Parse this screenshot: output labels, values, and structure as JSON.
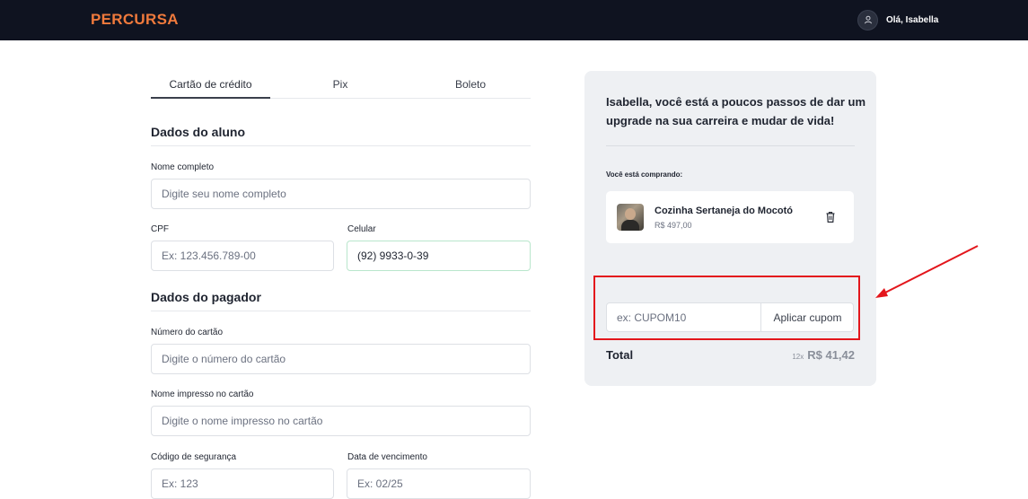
{
  "header": {
    "logo": "PERCURSA",
    "greeting": "Olá, Isabella",
    "user_icon": "user-icon"
  },
  "tabs": [
    {
      "label": "Cartão de crédito",
      "active": true
    },
    {
      "label": "Pix",
      "active": false
    },
    {
      "label": "Boleto",
      "active": false
    }
  ],
  "student": {
    "title": "Dados do aluno",
    "full_name": {
      "label": "Nome completo",
      "placeholder": "Digite seu nome completo"
    },
    "cpf": {
      "label": "CPF",
      "placeholder": "Ex: 123.456.789-00"
    },
    "phone": {
      "label": "Celular",
      "value": "(92) 9933-0-39"
    }
  },
  "payer": {
    "title": "Dados do pagador",
    "card_number": {
      "label": "Número do cartão",
      "placeholder": "Digite o número do cartão"
    },
    "card_name": {
      "label": "Nome impresso no cartão",
      "placeholder": "Digite o nome impresso no cartão"
    },
    "security_code": {
      "label": "Código de segurança",
      "placeholder": "Ex: 123"
    },
    "expiry": {
      "label": "Data de vencimento",
      "placeholder": "Ex: 02/25"
    }
  },
  "summary": {
    "headline": "Isabella, você está a poucos passos de dar um upgrade na sua carreira e mudar de vida!",
    "buying_label": "Você está comprando:",
    "product": {
      "name": "Cozinha Sertaneja do Mocotó",
      "price": "R$ 497,00",
      "delete_icon": "trash-icon"
    },
    "coupon": {
      "placeholder": "ex: CUPOM10",
      "button": "Aplicar cupom"
    },
    "total": {
      "label": "Total",
      "installments": "12x",
      "amount": "R$ 41,42"
    }
  },
  "colors": {
    "header_bg": "#0f1320",
    "brand": "#f07a3c",
    "panel_bg": "#eef0f3",
    "annotation": "#e3161c"
  }
}
